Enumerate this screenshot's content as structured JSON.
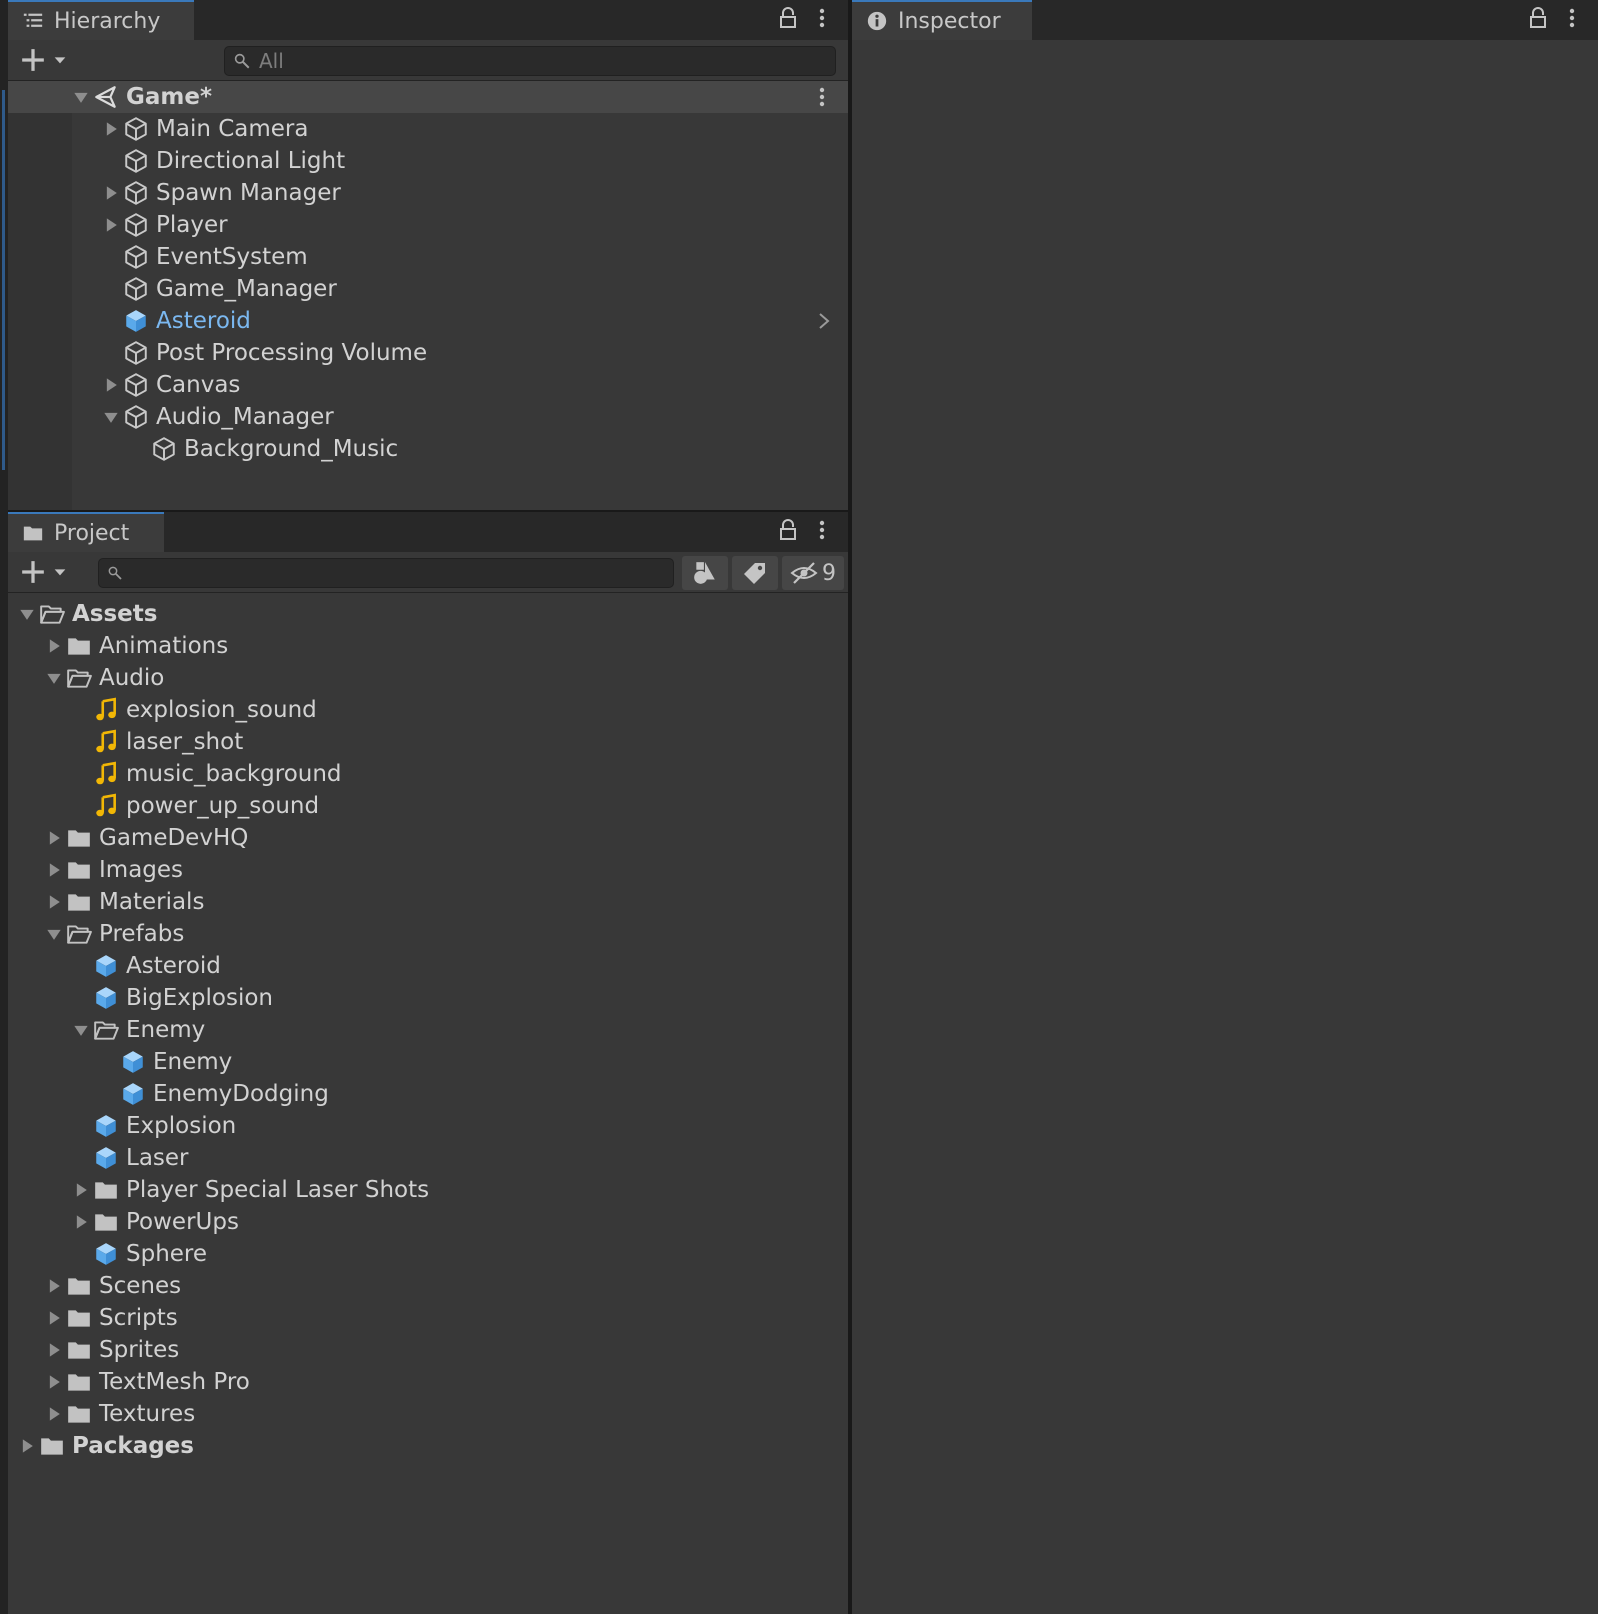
{
  "hierarchy": {
    "tab_label": "Hierarchy",
    "search_placeholder": "All",
    "scene": {
      "name": "Game*"
    },
    "items": [
      {
        "label": "Main Camera",
        "depth": 1,
        "arrow": "right",
        "icon": "gameobject"
      },
      {
        "label": "Directional Light",
        "depth": 1,
        "arrow": "none",
        "icon": "gameobject"
      },
      {
        "label": "Spawn Manager",
        "depth": 1,
        "arrow": "right",
        "icon": "gameobject"
      },
      {
        "label": "Player",
        "depth": 1,
        "arrow": "right",
        "icon": "gameobject"
      },
      {
        "label": "EventSystem",
        "depth": 1,
        "arrow": "none",
        "icon": "gameobject"
      },
      {
        "label": "Game_Manager",
        "depth": 1,
        "arrow": "none",
        "icon": "gameobject"
      },
      {
        "label": "Asteroid",
        "depth": 1,
        "arrow": "none",
        "icon": "prefab",
        "prefab": true
      },
      {
        "label": "Post Processing Volume",
        "depth": 1,
        "arrow": "none",
        "icon": "gameobject"
      },
      {
        "label": "Canvas",
        "depth": 1,
        "arrow": "right",
        "icon": "gameobject"
      },
      {
        "label": "Audio_Manager",
        "depth": 1,
        "arrow": "down",
        "icon": "gameobject"
      },
      {
        "label": "Background_Music",
        "depth": 2,
        "arrow": "none",
        "icon": "gameobject"
      }
    ]
  },
  "project": {
    "tab_label": "Project",
    "search_placeholder": "",
    "hidden_count": "9",
    "items": [
      {
        "label": "Assets",
        "depth": 0,
        "arrow": "down",
        "icon": "folder-open",
        "bold": true
      },
      {
        "label": "Animations",
        "depth": 1,
        "arrow": "right",
        "icon": "folder"
      },
      {
        "label": "Audio",
        "depth": 1,
        "arrow": "down",
        "icon": "folder-open"
      },
      {
        "label": "explosion_sound",
        "depth": 2,
        "arrow": "none",
        "icon": "audio"
      },
      {
        "label": "laser_shot",
        "depth": 2,
        "arrow": "none",
        "icon": "audio"
      },
      {
        "label": "music_background",
        "depth": 2,
        "arrow": "none",
        "icon": "audio"
      },
      {
        "label": "power_up_sound",
        "depth": 2,
        "arrow": "none",
        "icon": "audio"
      },
      {
        "label": "GameDevHQ",
        "depth": 1,
        "arrow": "right",
        "icon": "folder"
      },
      {
        "label": "Images",
        "depth": 1,
        "arrow": "right",
        "icon": "folder"
      },
      {
        "label": "Materials",
        "depth": 1,
        "arrow": "right",
        "icon": "folder"
      },
      {
        "label": "Prefabs",
        "depth": 1,
        "arrow": "down",
        "icon": "folder-open"
      },
      {
        "label": "Asteroid",
        "depth": 2,
        "arrow": "none",
        "icon": "prefab"
      },
      {
        "label": "BigExplosion",
        "depth": 2,
        "arrow": "none",
        "icon": "prefab"
      },
      {
        "label": "Enemy",
        "depth": 2,
        "arrow": "down",
        "icon": "folder-open"
      },
      {
        "label": "Enemy",
        "depth": 3,
        "arrow": "none",
        "icon": "prefab"
      },
      {
        "label": "EnemyDodging",
        "depth": 3,
        "arrow": "none",
        "icon": "prefab"
      },
      {
        "label": "Explosion",
        "depth": 2,
        "arrow": "none",
        "icon": "prefab"
      },
      {
        "label": "Laser",
        "depth": 2,
        "arrow": "none",
        "icon": "prefab"
      },
      {
        "label": "Player Special Laser Shots",
        "depth": 2,
        "arrow": "right",
        "icon": "folder"
      },
      {
        "label": "PowerUps",
        "depth": 2,
        "arrow": "right",
        "icon": "folder"
      },
      {
        "label": "Sphere",
        "depth": 2,
        "arrow": "none",
        "icon": "prefab"
      },
      {
        "label": "Scenes",
        "depth": 1,
        "arrow": "right",
        "icon": "folder"
      },
      {
        "label": "Scripts",
        "depth": 1,
        "arrow": "right",
        "icon": "folder"
      },
      {
        "label": "Sprites",
        "depth": 1,
        "arrow": "right",
        "icon": "folder"
      },
      {
        "label": "TextMesh Pro",
        "depth": 1,
        "arrow": "right",
        "icon": "folder"
      },
      {
        "label": "Textures",
        "depth": 1,
        "arrow": "right",
        "icon": "folder"
      },
      {
        "label": "Packages",
        "depth": 0,
        "arrow": "right",
        "icon": "folder",
        "bold": true
      }
    ]
  },
  "inspector": {
    "tab_label": "Inspector"
  },
  "colors": {
    "accent": "#3a79bb",
    "prefab": "#7bb8f0",
    "audio": "#f2b705",
    "folder": "#c2c2c2"
  }
}
